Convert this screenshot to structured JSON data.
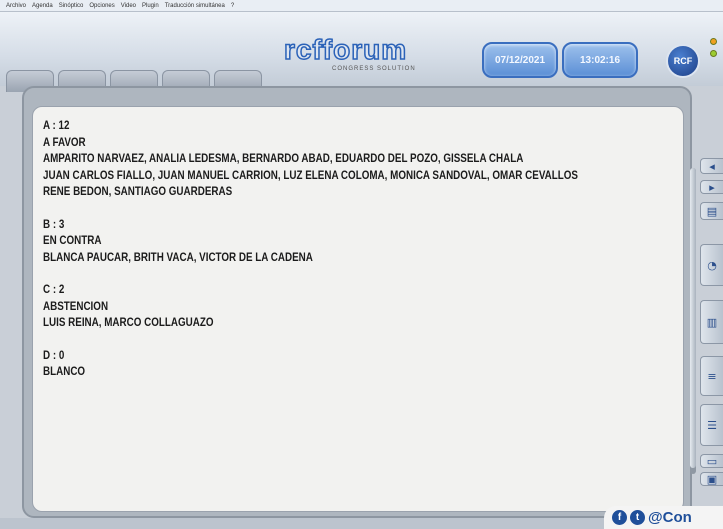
{
  "menu": {
    "items": [
      "Archivo",
      "Agenda",
      "Sinóptico",
      "Opciones",
      "Video",
      "Plugin",
      "Traducción simultánea",
      "?"
    ]
  },
  "header": {
    "logo_text": "rcfforum",
    "logo_subtitle": "CONGRESS SOLUTION",
    "date": "07/12/2021",
    "time": "13:02:16",
    "badge": "RCF"
  },
  "results": [
    {
      "option": "A : 12",
      "label": "A FAVOR",
      "members": [
        "AMPARITO NARVAEZ, ANALIA LEDESMA, BERNARDO ABAD, EDUARDO DEL POZO, GISSELA CHALA",
        "JUAN CARLOS FIALLO, JUAN MANUEL CARRION, LUZ ELENA COLOMA, MONICA SANDOVAL, OMAR CEVALLOS",
        "RENE BEDON, SANTIAGO GUARDERAS"
      ]
    },
    {
      "option": "B : 3",
      "label": "EN CONTRA",
      "members": [
        "BLANCA PAUCAR, BRITH VACA, VICTOR DE LA CADENA"
      ]
    },
    {
      "option": "C : 2",
      "label": "ABSTENCION",
      "members": [
        "LUIS REINA, MARCO COLLAGUAZO"
      ]
    },
    {
      "option": "D : 0",
      "label": "BLANCO",
      "members": []
    }
  ],
  "watermark": {
    "icons": [
      "facebook-icon",
      "twitter-icon"
    ],
    "text": "@Con"
  }
}
